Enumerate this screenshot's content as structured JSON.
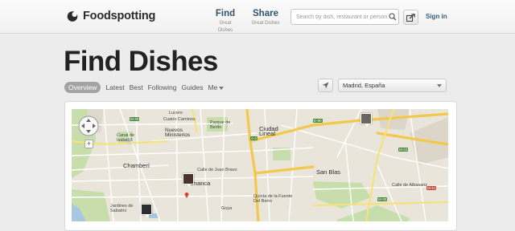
{
  "header": {
    "brand": "Foodspotting",
    "nav": [
      {
        "label": "Find",
        "sublabel": "Great Dishes"
      },
      {
        "label": "Share",
        "sublabel": "Great Dishes"
      }
    ],
    "search_placeholder": "Search by dish, restaurant or person",
    "signin_label": "Sign in"
  },
  "page": {
    "title": "Find Dishes",
    "tabs": [
      {
        "label": "Overview",
        "active": true
      },
      {
        "label": "Latest"
      },
      {
        "label": "Best"
      },
      {
        "label": "Following"
      },
      {
        "label": "Guides"
      },
      {
        "label": "Me"
      }
    ],
    "location": "Madrid, España"
  },
  "map": {
    "labels": {
      "lucero": "Lucero",
      "cuatro_caminos": "Cuatro Caminos",
      "ciudad_lineal": "Ciudad Lineal",
      "parque_berlin": "Parque de Berlín",
      "nuevos_ministerios": "Nuevos Ministerios",
      "canal_isabel": "Canal de Isabel II",
      "chamberi": "Chamberí",
      "san_blas": "San Blas",
      "calle_juan_bravo": "Calle de Juan Bravo",
      "fuente_berro": "Quinta de la Fuente Del Berro",
      "jardines_sabatini": "Jardines de Sabatini",
      "calle_albasanz": "Calle de Albasanz",
      "goya": "Goya",
      "salamanca_partial": "lamanca"
    },
    "roads": [
      "M-30",
      "A-2",
      "M-30",
      "M-21",
      "E-90",
      "M-23"
    ],
    "zoom_in": "+",
    "colors": {
      "water": "#a9c7df",
      "park": "#c7deac",
      "highway": "#f2c94c",
      "road": "#ffffff"
    }
  }
}
